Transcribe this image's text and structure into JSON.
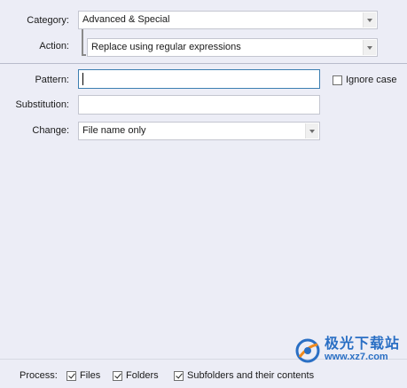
{
  "category": {
    "label": "Category:",
    "value": "Advanced & Special"
  },
  "action": {
    "label": "Action:",
    "value": "Replace using regular expressions"
  },
  "pattern": {
    "label": "Pattern:",
    "value": ""
  },
  "ignore_case": {
    "label": "Ignore case",
    "checked": false
  },
  "substitution": {
    "label": "Substitution:",
    "value": ""
  },
  "change": {
    "label": "Change:",
    "value": "File name only"
  },
  "process": {
    "label": "Process:",
    "files": {
      "label": "Files",
      "checked": true
    },
    "folders": {
      "label": "Folders",
      "checked": true
    },
    "subfolders": {
      "label": "Subfolders and their contents",
      "checked": true
    }
  },
  "watermark": {
    "text": "极光下载站",
    "url": "www.xz7.com"
  },
  "colors": {
    "background": "#ecedf6",
    "focus_border": "#3c7fb1",
    "watermark": "#2a6fc4"
  }
}
